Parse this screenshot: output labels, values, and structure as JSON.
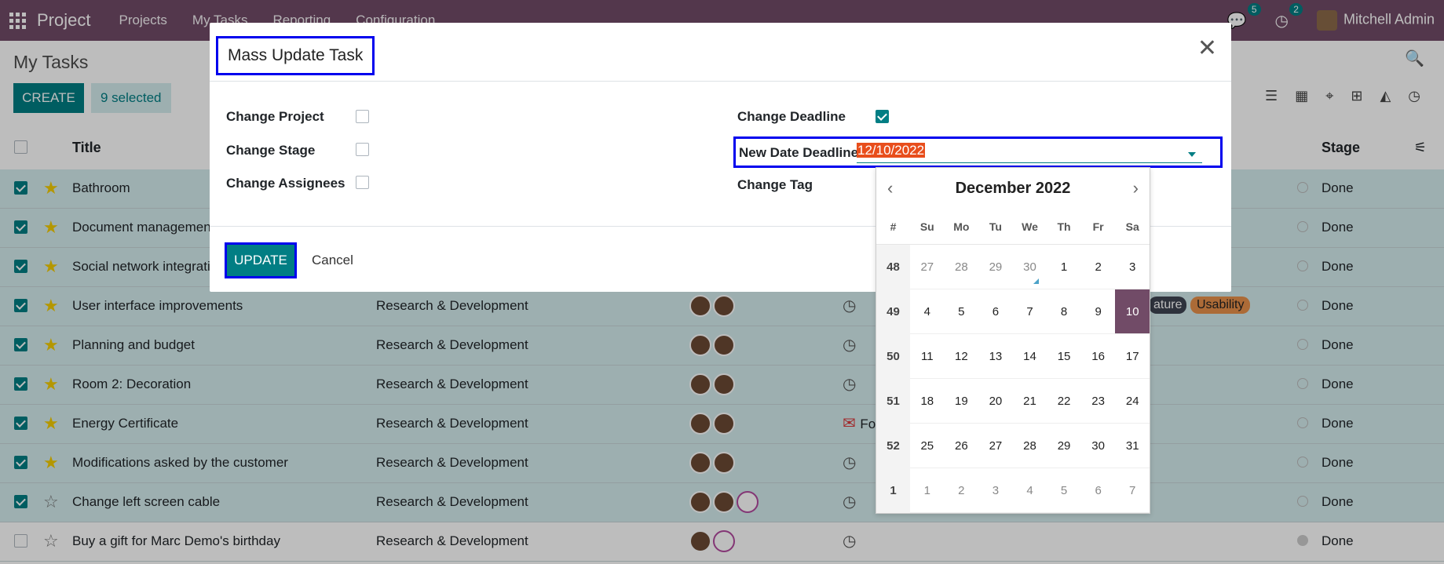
{
  "navbar": {
    "brand": "Project",
    "menu": [
      "Projects",
      "My Tasks",
      "Reporting",
      "Configuration"
    ],
    "messages_count": "5",
    "activities_count": "2",
    "user": "Mitchell Admin"
  },
  "control": {
    "title": "My Tasks",
    "create_label": "CREATE",
    "selected_label": "9 selected"
  },
  "list": {
    "headers": {
      "title": "Title",
      "stage": "Stage"
    },
    "rows": [
      {
        "title": "Bathroom",
        "project": "",
        "stage": "Done"
      },
      {
        "title": "Document management",
        "project": "",
        "stage": "Done"
      },
      {
        "title": "Social network integration",
        "project": "",
        "stage": "Done"
      },
      {
        "title": "User interface improvements",
        "project": "Research & Development",
        "stage": "Done",
        "tags": [
          "ature",
          "Usability"
        ]
      },
      {
        "title": "Planning and budget",
        "project": "Research & Development",
        "stage": "Done"
      },
      {
        "title": "Room 2: Decoration",
        "project": "Research & Development",
        "stage": "Done"
      },
      {
        "title": "Energy Certificate",
        "project": "Research & Development",
        "stage": "Done",
        "activity_text": "Fo"
      },
      {
        "title": "Modifications asked by the customer",
        "project": "Research & Development",
        "stage": "Done"
      },
      {
        "title": "Change left screen cable",
        "project": "Research & Development",
        "stage": "Done"
      },
      {
        "title": "Buy a gift for Marc Demo's birthday",
        "project": "Research & Development",
        "stage": "Done"
      }
    ]
  },
  "modal": {
    "title": "Mass Update Task",
    "change_project": "Change Project",
    "change_stage": "Change Stage",
    "change_assignees": "Change Assignees",
    "change_deadline": "Change Deadline",
    "new_date_deadline": "New Date Deadline",
    "date_value": "12/10/2022",
    "change_tag": "Change Tag",
    "update_label": "UPDATE",
    "cancel_label": "Cancel"
  },
  "datepicker": {
    "month": "December 2022",
    "week_header": "#",
    "weekdays": [
      "Su",
      "Mo",
      "Tu",
      "We",
      "Th",
      "Fr",
      "Sa"
    ],
    "weeks": [
      {
        "wk": "48",
        "days": [
          "27",
          "28",
          "29",
          "30",
          "1",
          "2",
          "3"
        ]
      },
      {
        "wk": "49",
        "days": [
          "4",
          "5",
          "6",
          "7",
          "8",
          "9",
          "10"
        ]
      },
      {
        "wk": "50",
        "days": [
          "11",
          "12",
          "13",
          "14",
          "15",
          "16",
          "17"
        ]
      },
      {
        "wk": "51",
        "days": [
          "18",
          "19",
          "20",
          "21",
          "22",
          "23",
          "24"
        ]
      },
      {
        "wk": "52",
        "days": [
          "25",
          "26",
          "27",
          "28",
          "29",
          "30",
          "31"
        ]
      },
      {
        "wk": "1",
        "days": [
          "1",
          "2",
          "3",
          "4",
          "5",
          "6",
          "7"
        ]
      }
    ]
  },
  "colors": {
    "brand": "#714b67",
    "primary": "#017e84",
    "highlight_box": "#0000ee",
    "selection": "#e84e1c"
  }
}
